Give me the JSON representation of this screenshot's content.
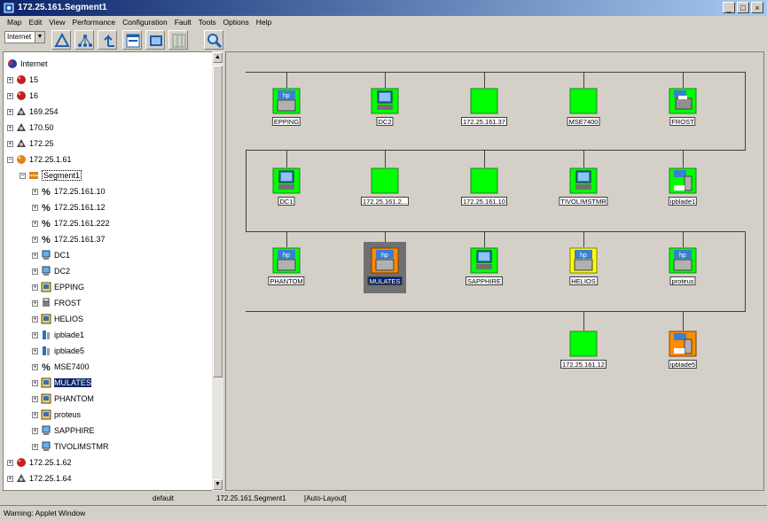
{
  "window": {
    "title": "172.25.161.Segment1"
  },
  "menu": [
    "Map",
    "Edit",
    "View",
    "Performance",
    "Configuration",
    "Fault",
    "Tools",
    "Options",
    "Help"
  ],
  "toolbar": {
    "layer_select": "Internet",
    "buttons": [
      "network-icon",
      "hierarchy-icon",
      "up-level-icon",
      "window-icon",
      "panel-icon",
      "grid-icon",
      "zoom-icon"
    ]
  },
  "tree": {
    "root": "Internet",
    "items": [
      {
        "label": "15",
        "icon": "red-network-icon"
      },
      {
        "label": "16",
        "icon": "red-network-icon"
      },
      {
        "label": "169.254",
        "icon": "network-icon"
      },
      {
        "label": "170.50",
        "icon": "network-icon"
      },
      {
        "label": "172.25",
        "icon": "network-icon"
      },
      {
        "label": "172.25.1.61",
        "icon": "orange-network-icon"
      },
      {
        "label": "Segment1",
        "icon": "segment-icon"
      },
      {
        "label": "172.25.161.10",
        "icon": "node-icon"
      },
      {
        "label": "172.25.161.12",
        "icon": "node-icon"
      },
      {
        "label": "172.25.161.222",
        "icon": "node-icon"
      },
      {
        "label": "172.25.161.37",
        "icon": "node-icon"
      },
      {
        "label": "DC1",
        "icon": "computer-icon"
      },
      {
        "label": "DC2",
        "icon": "computer-icon"
      },
      {
        "label": "EPPING",
        "icon": "server-icon"
      },
      {
        "label": "FROST",
        "icon": "printer-icon"
      },
      {
        "label": "HELIOS",
        "icon": "server-icon"
      },
      {
        "label": "ipblade1",
        "icon": "blade-icon"
      },
      {
        "label": "ipblade5",
        "icon": "blade-icon"
      },
      {
        "label": "MSE7400",
        "icon": "node-icon"
      },
      {
        "label": "MULATES",
        "icon": "server-icon"
      },
      {
        "label": "PHANTOM",
        "icon": "server-icon"
      },
      {
        "label": "proteus",
        "icon": "server-icon"
      },
      {
        "label": "SAPPHIRE",
        "icon": "computer-icon"
      },
      {
        "label": "TIVOLIMSTMR",
        "icon": "computer-icon"
      },
      {
        "label": "172.25.1.62",
        "icon": "red-network-icon"
      },
      {
        "label": "172.25.1.64",
        "icon": "network-icon"
      }
    ]
  },
  "map_nodes": {
    "row1": [
      "EPPING",
      "DC2",
      "172.25.161.37",
      "MSE7400",
      "FROST"
    ],
    "row2": [
      "DC1",
      "172.25.161.2...",
      "172.25.161.10",
      "TIVOLIMSTMR",
      "ipblade1"
    ],
    "row3": [
      "PHANTOM",
      "MULATES",
      "SAPPHIRE",
      "HELIOS",
      "proteus"
    ],
    "row4": [
      "172.25.161.12",
      "ipblade5"
    ]
  },
  "status": {
    "left": "default",
    "mid": "172.25.161.Segment1",
    "right": "[Auto-Layout]"
  },
  "warning": "Warning: Applet Window",
  "colors": {
    "node_green": "#00ff00",
    "selected": "#0a246a",
    "status_orange": "#ff8c00",
    "status_yellow": "#ffff00"
  }
}
